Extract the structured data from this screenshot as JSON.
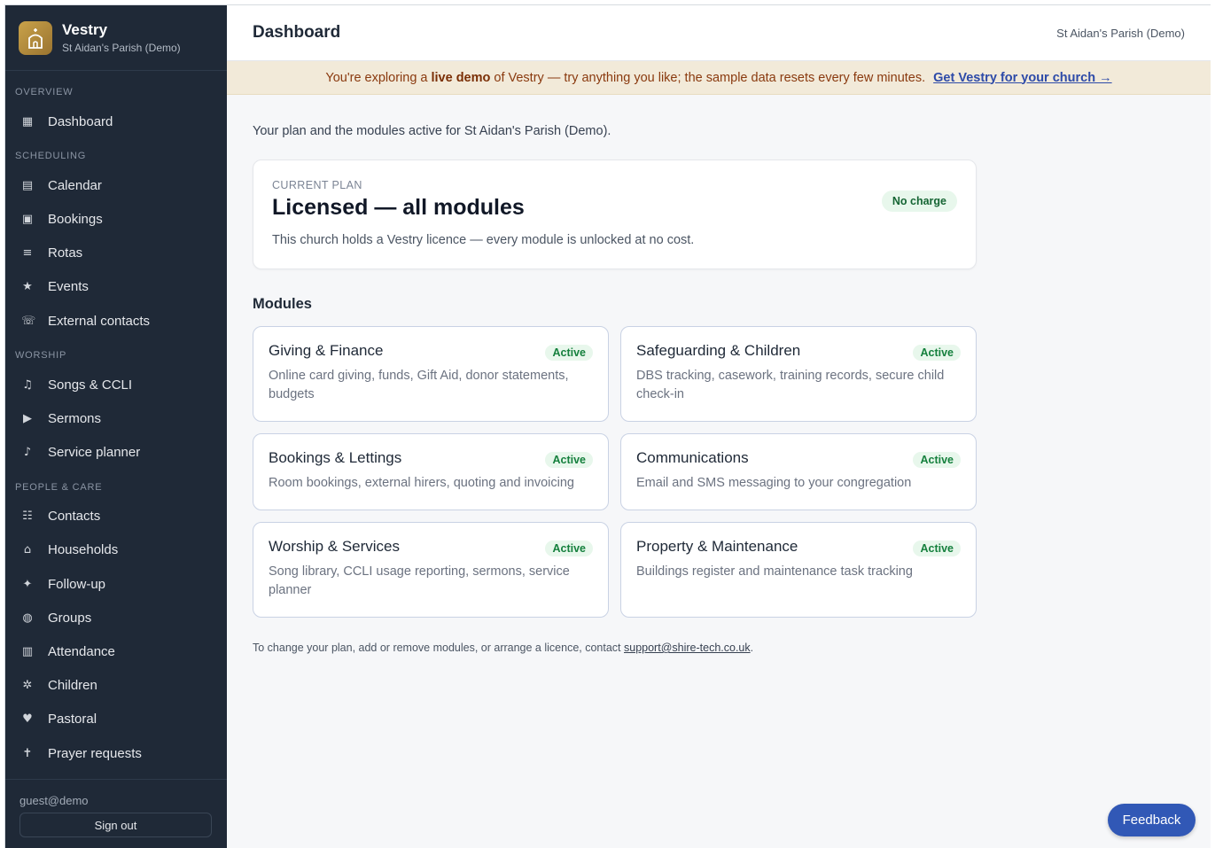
{
  "brand": {
    "name": "Vestry",
    "parish": "St Aidan's Parish (Demo)"
  },
  "sidebar": {
    "sections": [
      {
        "title": "OVERVIEW",
        "items": [
          {
            "label": "Dashboard",
            "icon": "▦",
            "icon_name": "dashboard-icon"
          }
        ]
      },
      {
        "title": "SCHEDULING",
        "items": [
          {
            "label": "Calendar",
            "icon": "▤",
            "icon_name": "calendar-icon"
          },
          {
            "label": "Bookings",
            "icon": "▣",
            "icon_name": "bookings-icon"
          },
          {
            "label": "Rotas",
            "icon": "≡",
            "icon_name": "rotas-icon"
          },
          {
            "label": "Events",
            "icon": "★",
            "icon_name": "star-icon"
          },
          {
            "label": "External contacts",
            "icon": "☏",
            "icon_name": "phone-icon"
          }
        ]
      },
      {
        "title": "WORSHIP",
        "items": [
          {
            "label": "Songs & CCLI",
            "icon": "♫",
            "icon_name": "music-icon"
          },
          {
            "label": "Sermons",
            "icon": "▶",
            "icon_name": "play-icon"
          },
          {
            "label": "Service planner",
            "icon": "♪",
            "icon_name": "note-icon"
          }
        ]
      },
      {
        "title": "PEOPLE & CARE",
        "items": [
          {
            "label": "Contacts",
            "icon": "☷",
            "icon_name": "contacts-icon"
          },
          {
            "label": "Households",
            "icon": "⌂",
            "icon_name": "house-icon"
          },
          {
            "label": "Follow-up",
            "icon": "✦",
            "icon_name": "sparkle-icon"
          },
          {
            "label": "Groups",
            "icon": "◍",
            "icon_name": "groups-icon"
          },
          {
            "label": "Attendance",
            "icon": "▥",
            "icon_name": "attendance-icon"
          },
          {
            "label": "Children",
            "icon": "✲",
            "icon_name": "children-icon"
          },
          {
            "label": "Pastoral",
            "icon": "♥",
            "icon_name": "heart-icon"
          },
          {
            "label": "Prayer requests",
            "icon": "✝",
            "icon_name": "cross-icon"
          }
        ]
      }
    ],
    "user": "guest@demo",
    "sign_out": "Sign out"
  },
  "header": {
    "title": "Dashboard",
    "parish": "St Aidan's Parish (Demo)"
  },
  "banner": {
    "pre": "You're exploring a",
    "bold": "live demo",
    "post": "of Vestry — try anything you like; the sample data resets every few minutes.",
    "link": "Get Vestry for your church →"
  },
  "intro": "Your plan and the modules active for St Aidan's Parish (Demo).",
  "plan": {
    "label": "CURRENT PLAN",
    "title": "Licensed — all modules",
    "description": "This church holds a Vestry licence — every module is unlocked at no cost.",
    "badge": "No charge"
  },
  "modules_heading": "Modules",
  "modules": [
    {
      "title": "Giving & Finance",
      "status": "Active",
      "description": "Online card giving, funds, Gift Aid, donor statements, budgets",
      "tall": true
    },
    {
      "title": "Safeguarding & Children",
      "status": "Active",
      "description": "DBS tracking, casework, training records, secure child check-in",
      "tall": true
    },
    {
      "title": "Bookings & Lettings",
      "status": "Active",
      "description": "Room bookings, external hirers, quoting and invoicing",
      "tall": false
    },
    {
      "title": "Communications",
      "status": "Active",
      "description": "Email and SMS messaging to your congregation",
      "tall": false
    },
    {
      "title": "Worship & Services",
      "status": "Active",
      "description": "Song library, CCLI usage reporting, sermons, service planner",
      "tall": true
    },
    {
      "title": "Property & Maintenance",
      "status": "Active",
      "description": "Buildings register and maintenance task tracking",
      "tall": true
    }
  ],
  "footnote": {
    "text": "To change your plan, add or remove modules, or arrange a licence, contact",
    "email": "support@shire-tech.co.uk",
    "end": "."
  },
  "feedback": "Feedback",
  "colors": {
    "sidebar": "#1f2937",
    "accent": "#3158b6",
    "banner_bg": "#f2ead9",
    "active_badge": "#15803d"
  }
}
